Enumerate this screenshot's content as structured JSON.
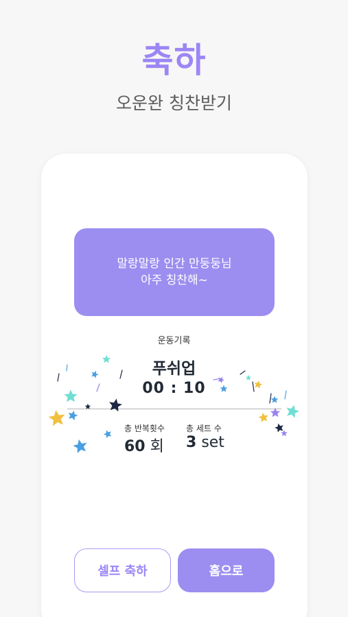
{
  "header": {
    "title": "축하",
    "subtitle": "오운완 칭찬받기"
  },
  "praise": {
    "line1": "말랑말랑 인간 만둥둥님",
    "line2": "아주 칭찬해~"
  },
  "record": {
    "label": "운동기록",
    "exercise_name": "푸쉬업",
    "time": "00 : 10"
  },
  "stats": {
    "reps_label": "총 반복횟수",
    "reps_value": "60",
    "reps_unit": "회",
    "sets_label": "총 세트 수",
    "sets_value": "3",
    "sets_unit": "set"
  },
  "buttons": {
    "self_celebrate": "셀프 축하",
    "home": "홈으로"
  },
  "colors": {
    "accent": "#9c86f5",
    "praise_bg": "#9c8ef0",
    "text_dark": "#222a35",
    "star_teal": "#6fdfd4",
    "star_blue": "#4a9fe0",
    "star_navy": "#1d2744",
    "star_gold": "#f0c040",
    "star_purple": "#9a84ee"
  }
}
